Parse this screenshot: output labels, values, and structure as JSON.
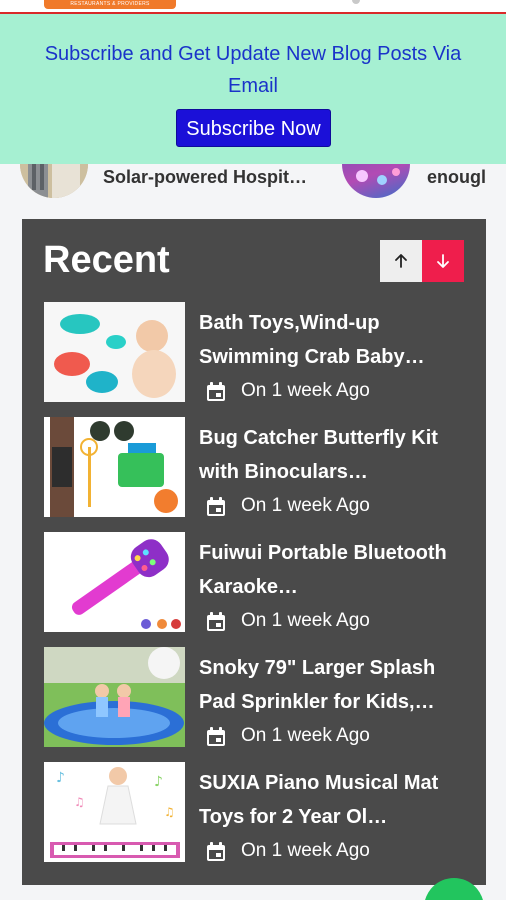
{
  "header": {
    "logo_text": "RESTAURANTS & PROVIDERS"
  },
  "subscribe": {
    "text": "Subscribe and Get Update New Blog Posts Via Email",
    "button_label": "Subscribe Now"
  },
  "trending": [
    {
      "title": "Solar-powered Hospit…"
    },
    {
      "title": "enougl"
    }
  ],
  "recent": {
    "heading": "Recent",
    "items": [
      {
        "title": "Bath Toys,Wind-up Swimming Crab Baby…",
        "date": "On 1 week Ago"
      },
      {
        "title": "Bug Catcher Butterfly Kit with Binoculars…",
        "date": "On 1 week Ago"
      },
      {
        "title": "Fuiwui Portable Bluetooth Karaoke…",
        "date": "On 1 week Ago"
      },
      {
        "title": "Snoky 79\" Larger Splash Pad Sprinkler for Kids,…",
        "date": "On 1 week Ago"
      },
      {
        "title": "SUXIA Piano Musical Mat Toys for 2 Year Ol…",
        "date": "On 1 week Ago"
      }
    ]
  },
  "colors": {
    "banner_bg": "#a6f0d2",
    "banner_text": "#1a33c9",
    "button_bg": "#1b10d8",
    "widget_bg": "#4a4a4a",
    "accent_red": "#ef1e4c",
    "fab_green": "#22c55e"
  },
  "icons": {
    "nav_up": "arrow-up-icon",
    "nav_down": "arrow-down-icon",
    "date": "calendar-icon"
  }
}
